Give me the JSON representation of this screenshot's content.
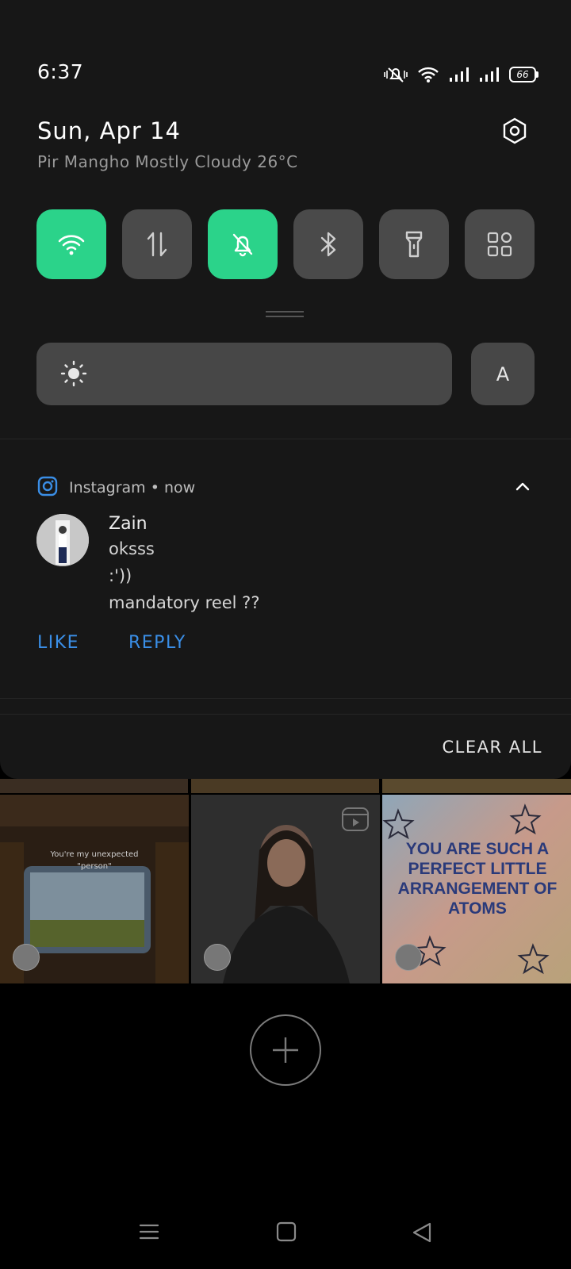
{
  "status_bar": {
    "time": "6:37",
    "battery": "66",
    "icons": [
      "mute-icon",
      "wifi-icon",
      "signal-icon",
      "signal-icon",
      "battery-icon"
    ]
  },
  "header": {
    "date": "Sun, Apr 14",
    "weather": "Pir Mangho Mostly Cloudy 26°C"
  },
  "quick_settings": {
    "tiles": [
      {
        "name": "wifi",
        "icon": "wifi-icon",
        "active": true
      },
      {
        "name": "mobile-data",
        "icon": "data-arrows-icon",
        "active": false
      },
      {
        "name": "mute",
        "icon": "bell-off-icon",
        "active": true
      },
      {
        "name": "bluetooth",
        "icon": "bluetooth-icon",
        "active": false
      },
      {
        "name": "flashlight",
        "icon": "flashlight-icon",
        "active": false
      },
      {
        "name": "more",
        "icon": "grid-icon",
        "active": false
      }
    ],
    "active_color": "#2bd38a",
    "inactive_color": "#4a4a4a"
  },
  "brightness": {
    "auto_label": "A"
  },
  "notification": {
    "app": "Instagram",
    "time": "now",
    "sender": "Zain",
    "messages": [
      "oksss",
      ":'))",
      "mandatory reel ??"
    ],
    "actions": {
      "like": "LIKE",
      "reply": "REPLY"
    },
    "action_color": "#3a8ee6"
  },
  "clear_all": "CLEAR ALL",
  "background_grid": {
    "quote_line1": "You're my unexpected",
    "quote_line2": "\"person\"",
    "poster_text": "YOU ARE SUCH A PERFECT LITTLE ARRANGEMENT OF ATOMS"
  }
}
